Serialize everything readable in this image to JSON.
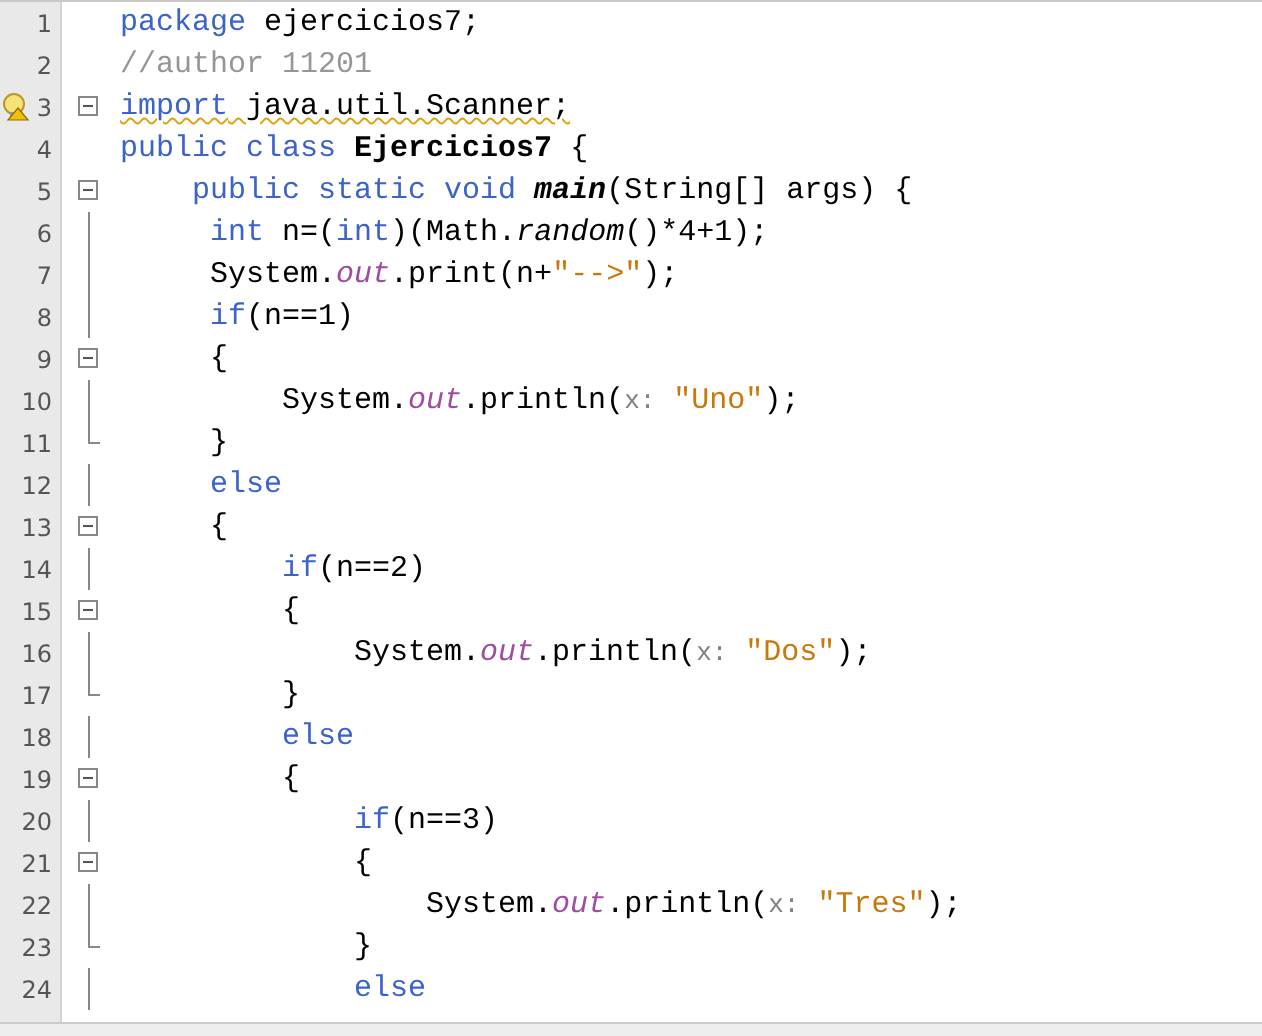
{
  "lines": [
    {
      "number": "1",
      "kind": "plain",
      "tokens": [
        {
          "kind": "kw",
          "text": "package"
        },
        {
          "kind": "plain",
          "text": " ejercicios7;"
        }
      ]
    },
    {
      "number": "2",
      "kind": "plain",
      "tokens": [
        {
          "kind": "comment",
          "text": "//author 11201"
        }
      ]
    },
    {
      "number": "3",
      "kind": "start",
      "hint": true,
      "tokens": [
        {
          "kind": "kw",
          "text": "import",
          "warning": true
        },
        {
          "kind": "plain",
          "text": " java.util.Scanner;",
          "warning": true
        }
      ]
    },
    {
      "number": "4",
      "kind": "plain",
      "tokens": [
        {
          "kind": "kw",
          "text": "public class"
        },
        {
          "kind": "bold",
          "text": " Ejercicios7"
        },
        {
          "kind": "plain",
          "text": " {"
        }
      ]
    },
    {
      "number": "5",
      "kind": "start",
      "tokens": [
        {
          "kind": "kw",
          "text": "    public static void"
        },
        {
          "kind": "method",
          "text": " main"
        },
        {
          "kind": "plain",
          "text": "(String[] args) {"
        }
      ]
    },
    {
      "number": "6",
      "kind": "body",
      "tokens": [
        {
          "kind": "kw",
          "text": "     int"
        },
        {
          "kind": "plain",
          "text": " n=("
        },
        {
          "kind": "kw",
          "text": "int"
        },
        {
          "kind": "plain",
          "text": ")(Math."
        },
        {
          "kind": "static",
          "text": "random"
        },
        {
          "kind": "plain",
          "text": "()*4+1);"
        }
      ]
    },
    {
      "number": "7",
      "kind": "body",
      "tokens": [
        {
          "kind": "plain",
          "text": "     System."
        },
        {
          "kind": "field",
          "text": "out"
        },
        {
          "kind": "plain",
          "text": ".print(n+"
        },
        {
          "kind": "string",
          "text": "\"-->\""
        },
        {
          "kind": "plain",
          "text": ");"
        }
      ]
    },
    {
      "number": "8",
      "kind": "body",
      "tokens": [
        {
          "kind": "kw",
          "text": "     if"
        },
        {
          "kind": "plain",
          "text": "(n==1)"
        }
      ]
    },
    {
      "number": "9",
      "kind": "start",
      "tokens": [
        {
          "kind": "plain",
          "text": "     {"
        }
      ]
    },
    {
      "number": "10",
      "kind": "body",
      "tokens": [
        {
          "kind": "plain",
          "text": "         System."
        },
        {
          "kind": "field",
          "text": "out"
        },
        {
          "kind": "plain",
          "text": ".println("
        },
        {
          "kind": "param",
          "text": "x:"
        },
        {
          "kind": "string",
          "text": " \"Uno\""
        },
        {
          "kind": "plain",
          "text": ");"
        }
      ]
    },
    {
      "number": "11",
      "kind": "end",
      "tokens": [
        {
          "kind": "plain",
          "text": "     }"
        }
      ]
    },
    {
      "number": "12",
      "kind": "body",
      "tokens": [
        {
          "kind": "kw",
          "text": "     else"
        }
      ]
    },
    {
      "number": "13",
      "kind": "start",
      "tokens": [
        {
          "kind": "plain",
          "text": "     {"
        }
      ]
    },
    {
      "number": "14",
      "kind": "body",
      "tokens": [
        {
          "kind": "kw",
          "text": "         if"
        },
        {
          "kind": "plain",
          "text": "(n==2)"
        }
      ]
    },
    {
      "number": "15",
      "kind": "start",
      "tokens": [
        {
          "kind": "plain",
          "text": "         {"
        }
      ]
    },
    {
      "number": "16",
      "kind": "body",
      "tokens": [
        {
          "kind": "plain",
          "text": "             System."
        },
        {
          "kind": "field",
          "text": "out"
        },
        {
          "kind": "plain",
          "text": ".println("
        },
        {
          "kind": "param",
          "text": "x:"
        },
        {
          "kind": "string",
          "text": " \"Dos\""
        },
        {
          "kind": "plain",
          "text": ");"
        }
      ]
    },
    {
      "number": "17",
      "kind": "end",
      "tokens": [
        {
          "kind": "plain",
          "text": "         }"
        }
      ]
    },
    {
      "number": "18",
      "kind": "body",
      "tokens": [
        {
          "kind": "kw",
          "text": "         else"
        }
      ]
    },
    {
      "number": "19",
      "kind": "start",
      "tokens": [
        {
          "kind": "plain",
          "text": "         {"
        }
      ]
    },
    {
      "number": "20",
      "kind": "body",
      "tokens": [
        {
          "kind": "kw",
          "text": "             if"
        },
        {
          "kind": "plain",
          "text": "(n==3)"
        }
      ]
    },
    {
      "number": "21",
      "kind": "start",
      "tokens": [
        {
          "kind": "plain",
          "text": "             {"
        }
      ]
    },
    {
      "number": "22",
      "kind": "body",
      "tokens": [
        {
          "kind": "plain",
          "text": "                 System."
        },
        {
          "kind": "field",
          "text": "out"
        },
        {
          "kind": "plain",
          "text": ".println("
        },
        {
          "kind": "param",
          "text": "x:"
        },
        {
          "kind": "string",
          "text": " \"Tres\""
        },
        {
          "kind": "plain",
          "text": ");"
        }
      ]
    },
    {
      "number": "23",
      "kind": "end",
      "tokens": [
        {
          "kind": "plain",
          "text": "             }"
        }
      ]
    },
    {
      "number": "24",
      "kind": "body",
      "tokens": [
        {
          "kind": "kw",
          "text": "             else"
        }
      ]
    }
  ]
}
